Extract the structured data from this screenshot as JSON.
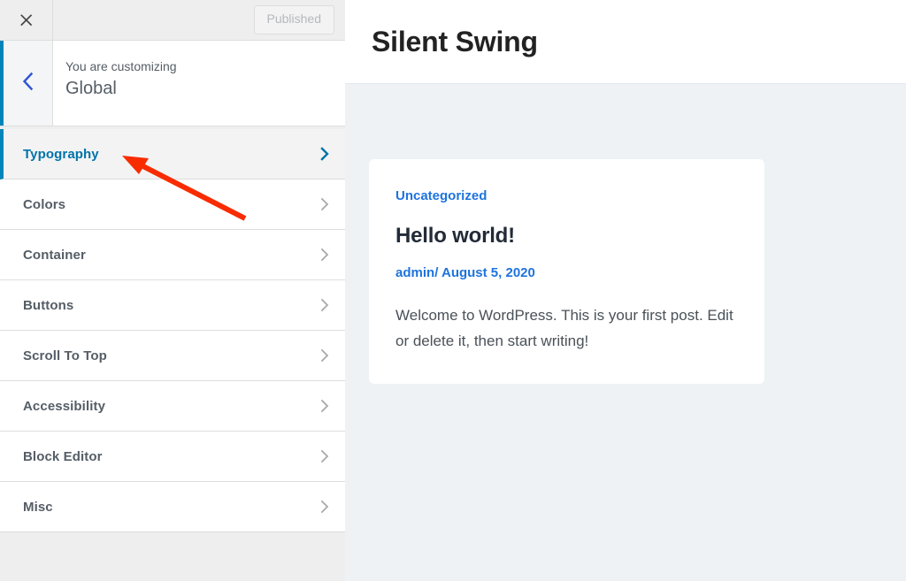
{
  "customizer": {
    "close_icon": "close-x-icon",
    "back_icon": "chevron-left-icon",
    "publish_button_label": "Published",
    "eyebrow": "You are customizing",
    "panel_title": "Global",
    "accent_color": "#0085ba",
    "active_link_color": "#0073aa",
    "menu": [
      {
        "label": "Typography",
        "active": true,
        "chevron": "chevron-right-icon"
      },
      {
        "label": "Colors",
        "active": false,
        "chevron": "chevron-right-icon"
      },
      {
        "label": "Container",
        "active": false,
        "chevron": "chevron-right-icon"
      },
      {
        "label": "Buttons",
        "active": false,
        "chevron": "chevron-right-icon"
      },
      {
        "label": "Scroll To Top",
        "active": false,
        "chevron": "chevron-right-icon"
      },
      {
        "label": "Accessibility",
        "active": false,
        "chevron": "chevron-right-icon"
      },
      {
        "label": "Block Editor",
        "active": false,
        "chevron": "chevron-right-icon"
      },
      {
        "label": "Misc",
        "active": false,
        "chevron": "chevron-right-icon"
      }
    ]
  },
  "preview": {
    "site_title": "Silent Swing",
    "background_color": "#eef2f5",
    "post": {
      "category": "Uncategorized",
      "title": "Hello world!",
      "author": "admin",
      "meta_separator": "/",
      "date": "August 5, 2020",
      "excerpt": "Welcome to WordPress. This is your first post. Edit or delete it, then start writing!",
      "link_color": "#1e73dd"
    }
  },
  "annotation": {
    "arrow_color": "#f92b00",
    "arrow_target": "Typography"
  }
}
